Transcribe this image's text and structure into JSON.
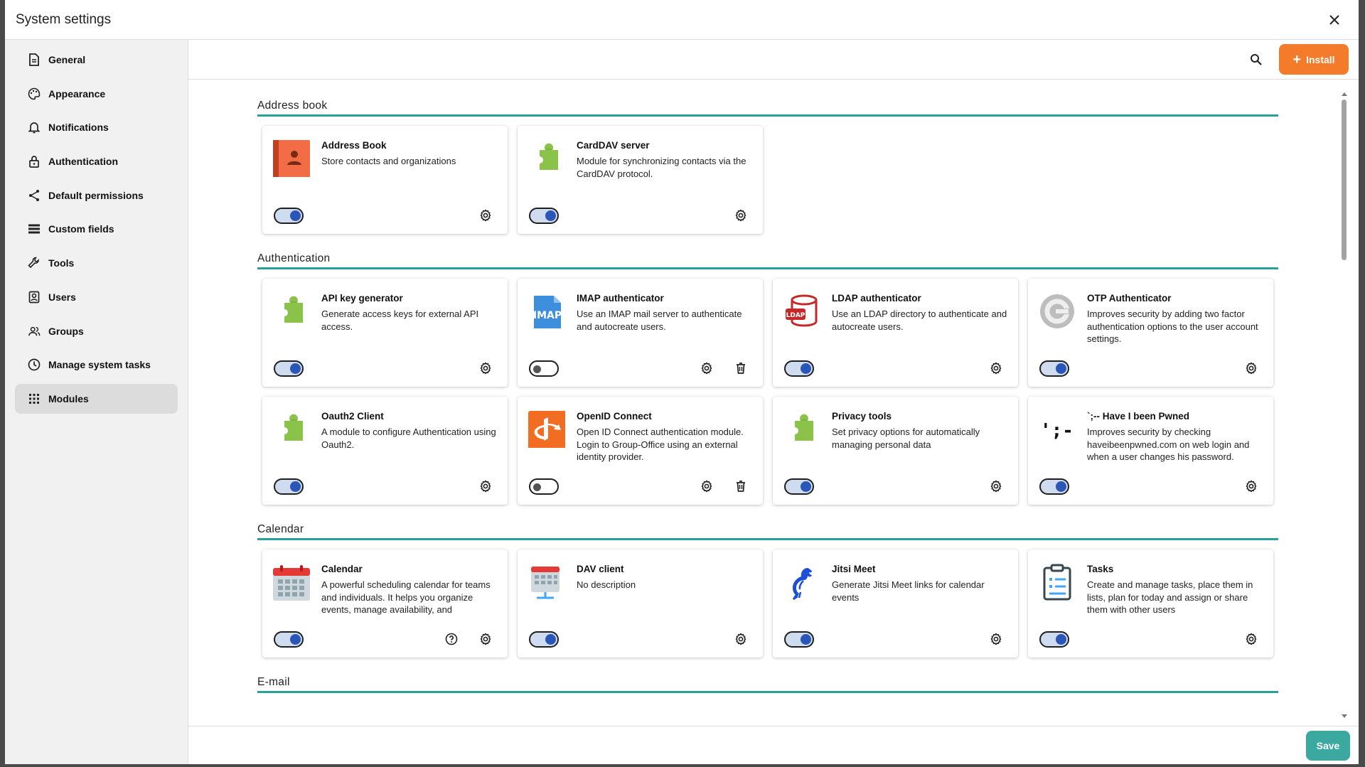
{
  "window": {
    "title": "System settings"
  },
  "sidebar": {
    "items": [
      {
        "label": "General",
        "icon": "document-icon"
      },
      {
        "label": "Appearance",
        "icon": "palette-icon"
      },
      {
        "label": "Notifications",
        "icon": "bell-icon"
      },
      {
        "label": "Authentication",
        "icon": "lock-icon"
      },
      {
        "label": "Default permissions",
        "icon": "share-icon"
      },
      {
        "label": "Custom fields",
        "icon": "list-icon"
      },
      {
        "label": "Tools",
        "icon": "wrench-icon"
      },
      {
        "label": "Users",
        "icon": "user-box-icon"
      },
      {
        "label": "Groups",
        "icon": "group-icon"
      },
      {
        "label": "Manage system tasks",
        "icon": "clock-icon"
      },
      {
        "label": "Modules",
        "icon": "apps-grid-icon",
        "active": true
      }
    ]
  },
  "toolbar": {
    "install_label": "Install",
    "install_color": "#f47b2a"
  },
  "sections": [
    {
      "title": "Address book",
      "modules": [
        {
          "name": "Address Book",
          "desc": "Store contacts and organizations",
          "enabled": true,
          "icon": "address-book-icon",
          "actions": [
            "settings"
          ]
        },
        {
          "name": "CardDAV server",
          "desc": "Module for synchronizing contacts via the CardDAV protocol.",
          "enabled": true,
          "icon": "puzzle-icon",
          "actions": [
            "settings"
          ]
        }
      ]
    },
    {
      "title": "Authentication",
      "modules": [
        {
          "name": "API key generator",
          "desc": "Generate access keys for external API access.",
          "enabled": true,
          "icon": "puzzle-icon",
          "actions": [
            "settings"
          ]
        },
        {
          "name": "IMAP authenticator",
          "desc": "Use an IMAP mail server to authenticate and autocreate users.",
          "enabled": false,
          "icon": "imap-icon",
          "icon_text": "IMAP",
          "actions": [
            "settings",
            "delete"
          ]
        },
        {
          "name": "LDAP authenticator",
          "desc": "Use an LDAP directory to authenticate and autocreate users.",
          "enabled": true,
          "icon": "ldap-icon",
          "icon_text": "LDAP",
          "actions": [
            "settings"
          ]
        },
        {
          "name": "OTP Authenticator",
          "desc": "Improves security by adding two factor authentication options to the user account settings.",
          "enabled": true,
          "icon": "otp-icon",
          "actions": [
            "settings"
          ]
        },
        {
          "name": "Oauth2 Client",
          "desc": "A module to configure Authentication using Oauth2.",
          "enabled": true,
          "icon": "puzzle-icon",
          "actions": [
            "settings"
          ]
        },
        {
          "name": "OpenID Connect",
          "desc": "Open ID Connect authentication module. Login to Group-Office using an external identity provider.",
          "enabled": false,
          "icon": "openid-icon",
          "actions": [
            "settings",
            "delete"
          ]
        },
        {
          "name": "Privacy tools",
          "desc": "Set privacy options for automatically managing personal data",
          "enabled": true,
          "icon": "puzzle-icon",
          "actions": [
            "settings"
          ]
        },
        {
          "name": "`;-- Have I been Pwned",
          "desc": "Improves security by checking haveibeenpwned.com on web login and when a user changes his password.",
          "enabled": true,
          "icon": "pwned-icon",
          "icon_text": "';--",
          "actions": [
            "settings"
          ]
        }
      ]
    },
    {
      "title": "Calendar",
      "modules": [
        {
          "name": "Calendar",
          "desc": "A powerful scheduling calendar for teams and individuals. It helps you organize events, manage availability, and",
          "enabled": true,
          "icon": "calendar-icon",
          "actions": [
            "help",
            "settings"
          ]
        },
        {
          "name": "DAV client",
          "desc": "No description",
          "enabled": true,
          "icon": "dav-calendar-icon",
          "actions": [
            "settings"
          ]
        },
        {
          "name": "Jitsi Meet",
          "desc": "Generate Jitsi Meet links for calendar events",
          "enabled": true,
          "icon": "jitsi-icon",
          "actions": [
            "settings"
          ]
        },
        {
          "name": "Tasks",
          "desc": "Create and manage tasks, place them in lists, plan for today and assign or share them with other users",
          "enabled": true,
          "icon": "tasks-icon",
          "actions": [
            "settings"
          ]
        }
      ]
    },
    {
      "title": "E-mail",
      "modules": []
    }
  ],
  "footer": {
    "save_label": "Save",
    "save_color": "#3ba9a0"
  },
  "colors": {
    "accent_teal": "#2aa198",
    "toggle_on": "#2a56b8",
    "puzzle_green": "#8bc34a"
  }
}
